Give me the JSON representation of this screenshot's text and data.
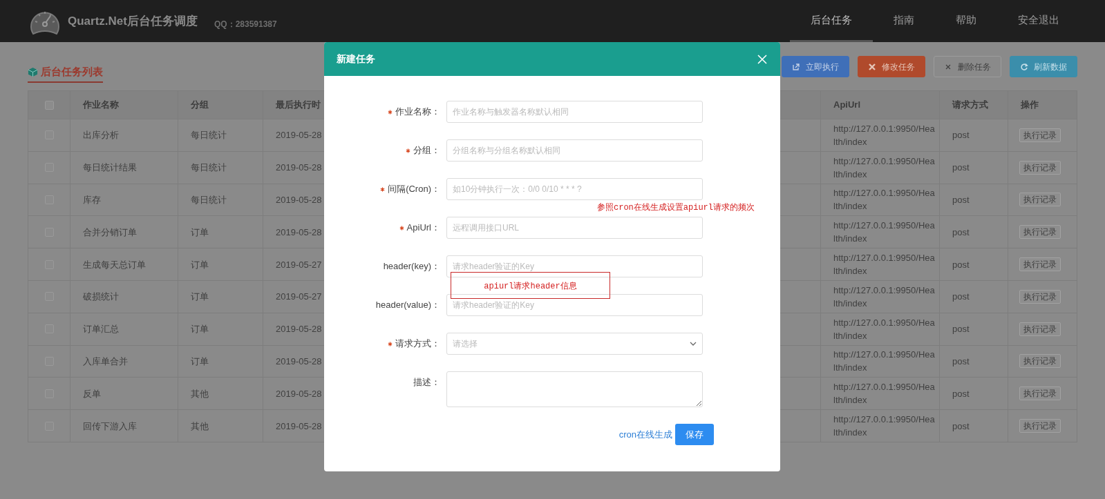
{
  "header": {
    "title": "Quartz.Net后台任务调度",
    "qq": "QQ：283591387",
    "nav": [
      {
        "label": "后台任务",
        "selected": true
      },
      {
        "label": "指南",
        "selected": false
      },
      {
        "label": "帮助",
        "selected": false
      },
      {
        "label": "安全退出",
        "selected": false
      }
    ]
  },
  "section_title": "后台任务列表",
  "toolbar": [
    {
      "kind": "run",
      "label": "立即执行"
    },
    {
      "kind": "edit",
      "label": "修改任务"
    },
    {
      "kind": "delete",
      "label": "删除任务"
    },
    {
      "kind": "refresh",
      "label": "刷新数据"
    }
  ],
  "table": {
    "select_all_checked": false,
    "columns": [
      "作业名称",
      "分组",
      "最后执行时",
      "ApiUrl",
      "请求方式",
      "操作"
    ],
    "rows": [
      {
        "checked": false,
        "name": "出库分析",
        "group": "每日统计",
        "time": "2019-05-28",
        "api": "http://127.0.0.1:9950/Health/index",
        "method": "post",
        "action": "执行记录"
      },
      {
        "checked": false,
        "name": "每日统计结果",
        "group": "每日统计",
        "time": "2019-05-28",
        "api": "http://127.0.0.1:9950/Health/index",
        "method": "post",
        "action": "执行记录"
      },
      {
        "checked": false,
        "name": "库存",
        "group": "每日统计",
        "time": "2019-05-28",
        "api": "http://127.0.0.1:9950/Health/index",
        "method": "post",
        "action": "执行记录"
      },
      {
        "checked": false,
        "name": "合并分销订单",
        "group": "订单",
        "time": "2019-05-28",
        "api": "http://127.0.0.1:9950/Health/index",
        "method": "post",
        "action": "执行记录"
      },
      {
        "checked": false,
        "name": "生成每天总订单",
        "group": "订单",
        "time": "2019-05-27",
        "api": "http://127.0.0.1:9950/Health/index",
        "method": "post",
        "action": "执行记录"
      },
      {
        "checked": false,
        "name": "破损统计",
        "group": "订单",
        "time": "2019-05-27",
        "api": "http://127.0.0.1:9950/Health/index",
        "method": "post",
        "action": "执行记录"
      },
      {
        "checked": false,
        "name": "订单汇总",
        "group": "订单",
        "time": "2019-05-28",
        "api": "http://127.0.0.1:9950/Health/index",
        "method": "post",
        "action": "执行记录"
      },
      {
        "checked": false,
        "name": "入库单合并",
        "group": "订单",
        "time": "2019-05-28",
        "api": "http://127.0.0.1:9950/Health/index",
        "method": "post",
        "action": "执行记录"
      },
      {
        "checked": false,
        "name": "反单",
        "group": "其他",
        "time": "2019-05-28",
        "api": "http://127.0.0.1:9950/Health/index",
        "method": "post",
        "action": "执行记录"
      },
      {
        "checked": false,
        "name": "回传下游入库",
        "group": "其他",
        "time": "2019-05-28",
        "api": "http://127.0.0.1:9950/Health/index",
        "method": "post",
        "action": "执行记录"
      }
    ]
  },
  "dialog": {
    "title": "新建任务",
    "fields": [
      {
        "kind": "input",
        "label": "作业名称：",
        "required": true,
        "placeholder": "作业名称与触发器名称默认相同"
      },
      {
        "kind": "input",
        "label": "分组：",
        "required": true,
        "placeholder": "分组名称与分组名称默认相同"
      },
      {
        "kind": "input",
        "label": "间隔(Cron)：",
        "required": true,
        "placeholder": "如10分钟执行一次：0/0 0/10 * * * ?"
      },
      {
        "kind": "input",
        "label": "ApiUrl：",
        "required": true,
        "placeholder": "远程调用接口URL"
      },
      {
        "kind": "input",
        "label": "header(key)：",
        "required": false,
        "placeholder": "请求header验证的Key"
      },
      {
        "kind": "input",
        "label": "header(value)：",
        "required": false,
        "placeholder": "请求header验证的Key"
      },
      {
        "kind": "select",
        "label": "请求方式：",
        "required": true,
        "placeholder": "请选择"
      },
      {
        "kind": "textarea",
        "label": "描述：",
        "required": false
      }
    ],
    "link": "cron在线生成",
    "save": "保存"
  },
  "annotations": [
    {
      "kind": "note",
      "text": "参照cron在线生成设置apiurl请求的频次"
    },
    {
      "kind": "boxed",
      "text": "apiurl请求header信息"
    }
  ]
}
